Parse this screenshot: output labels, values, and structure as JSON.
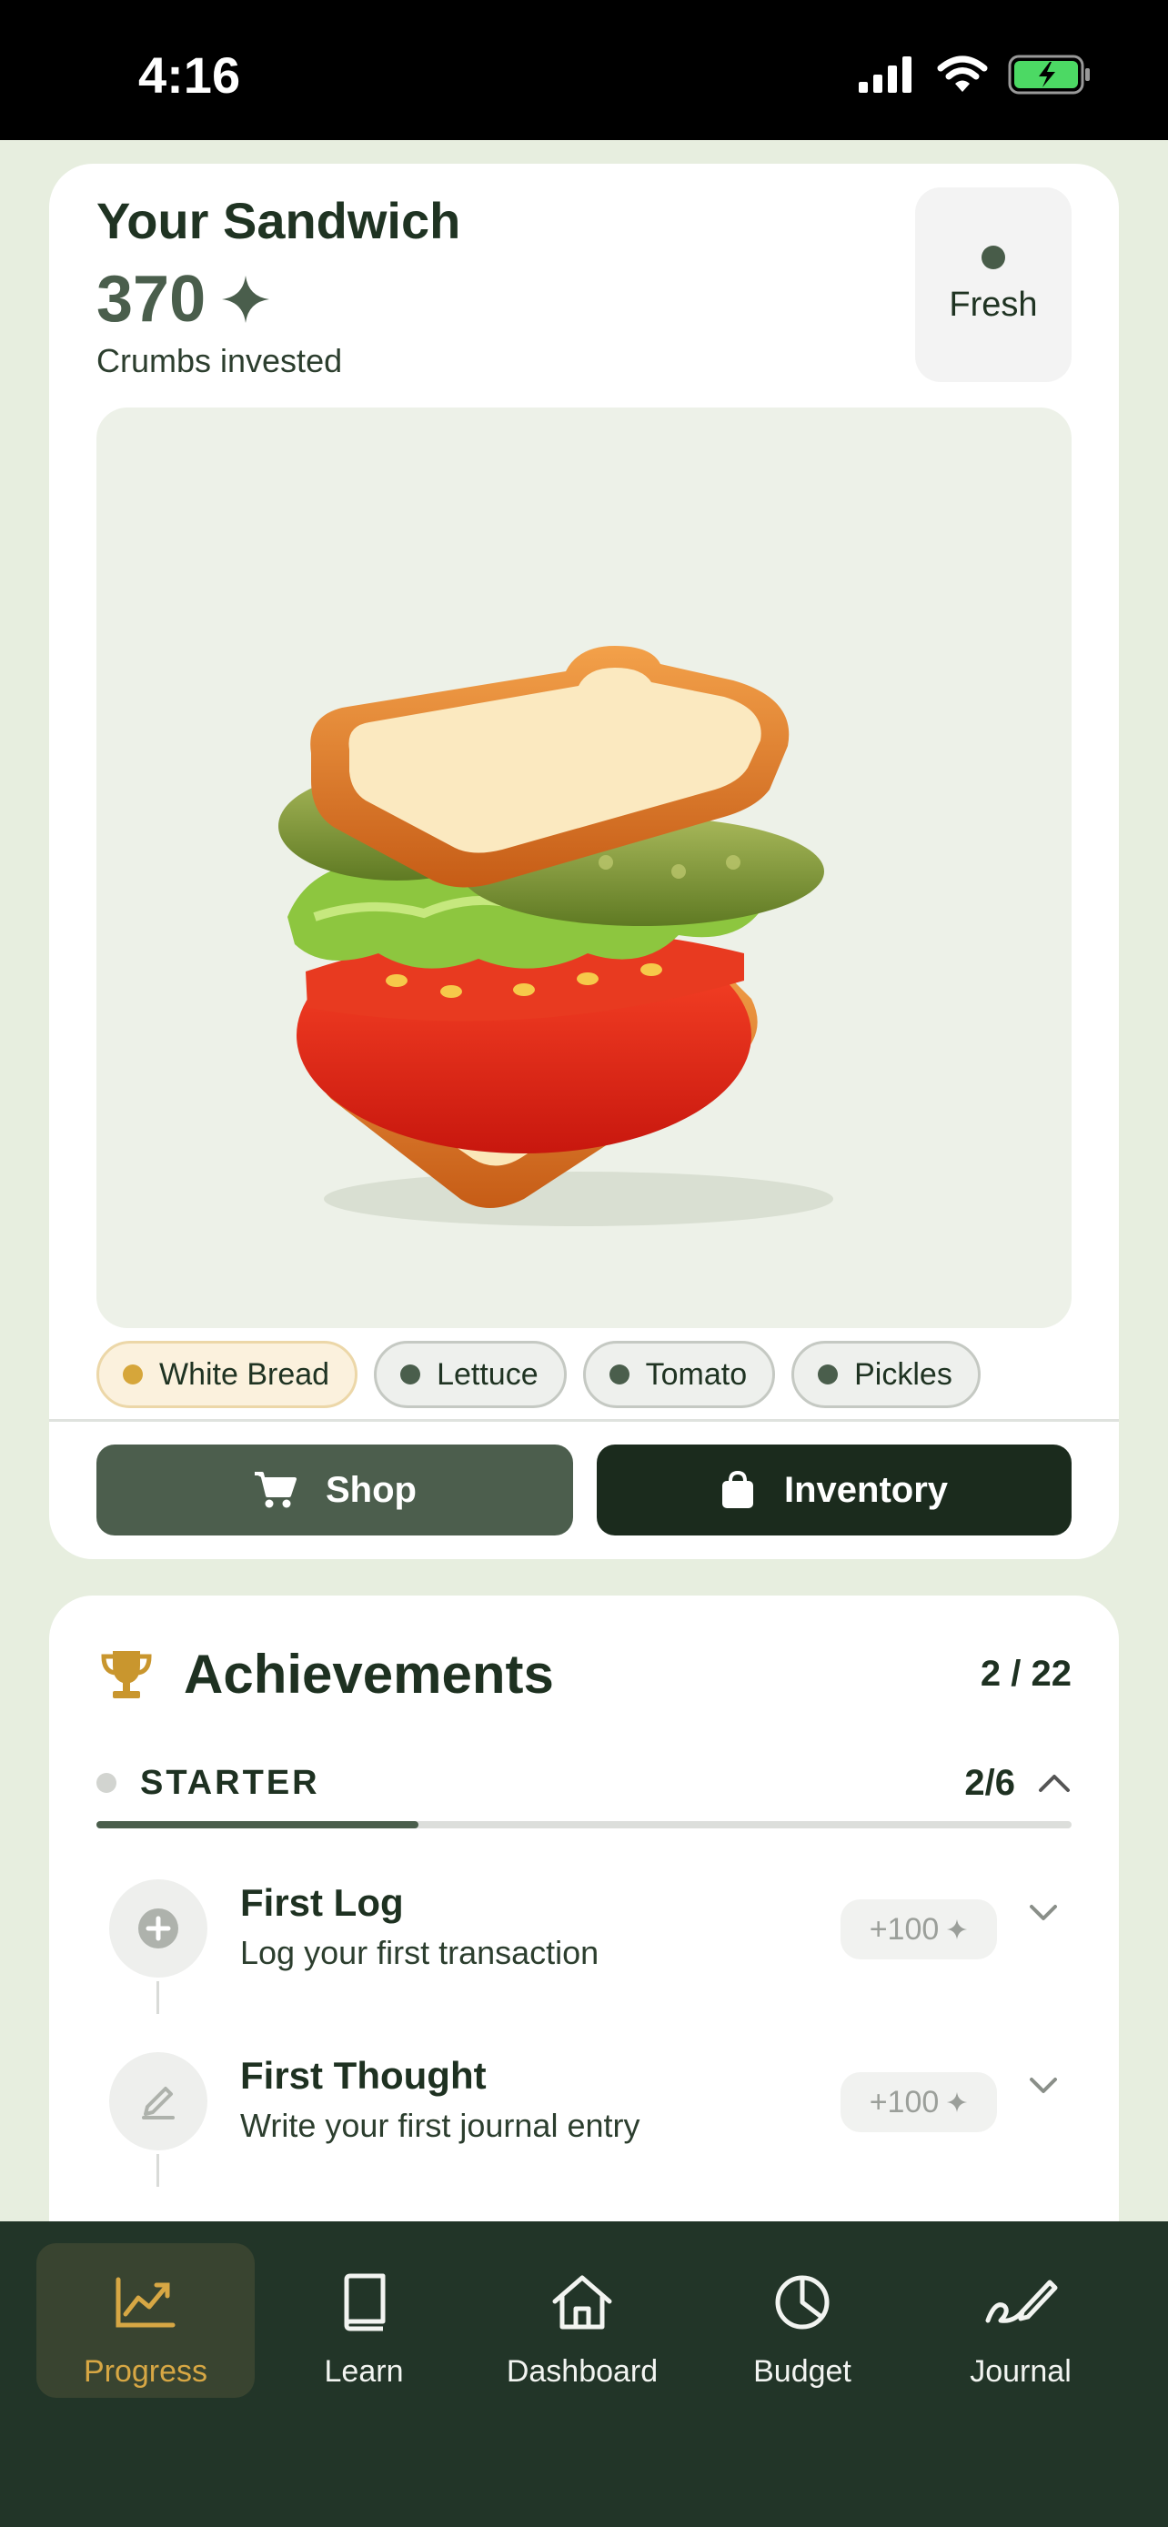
{
  "status_bar": {
    "time": "4:16"
  },
  "sandwich": {
    "title": "Your Sandwich",
    "crumbs_value": "370",
    "crumbs_label": "Crumbs invested",
    "freshness": "Fresh",
    "ingredients": [
      {
        "label": "White Bread",
        "active": true
      },
      {
        "label": "Lettuce",
        "active": false
      },
      {
        "label": "Tomato",
        "active": false
      },
      {
        "label": "Pickles",
        "active": false
      }
    ],
    "shop_label": "Shop",
    "inventory_label": "Inventory"
  },
  "achievements": {
    "title": "Achievements",
    "count": "2 / 22",
    "section": {
      "title": "STARTER",
      "count": "2/6",
      "progress": 0.33
    },
    "items": [
      {
        "name": "First Log",
        "description": "Log your first transaction",
        "reward": "+100",
        "icon": "plus-circle-icon"
      },
      {
        "name": "First Thought",
        "description": "Write your first journal entry",
        "reward": "+100",
        "icon": "pencil-icon"
      }
    ]
  },
  "tabs": [
    {
      "label": "Progress",
      "icon": "chart-icon",
      "active": true
    },
    {
      "label": "Learn",
      "icon": "book-icon",
      "active": false
    },
    {
      "label": "Dashboard",
      "icon": "home-icon",
      "active": false
    },
    {
      "label": "Budget",
      "icon": "pie-chart-icon",
      "active": false
    },
    {
      "label": "Journal",
      "icon": "signature-icon",
      "active": false
    }
  ],
  "colors": {
    "accent": "#d7a744",
    "dark": "#1b2b1d",
    "primary": "#4c5e4d",
    "background": "#e7eedf"
  }
}
